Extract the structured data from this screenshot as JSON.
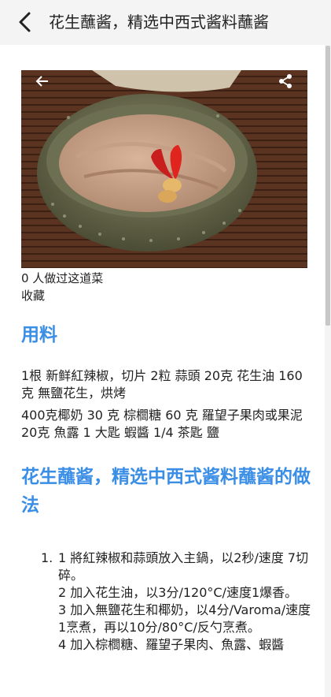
{
  "header": {
    "title": "花生蘸酱，精选中西式酱料蘸酱"
  },
  "hero": {
    "image_alt": "peanut dipping sauce bowl with red chili"
  },
  "meta": {
    "made_count": "0 人做过这道菜",
    "favorite": "收藏"
  },
  "ingredients_section": {
    "title": "用料",
    "lines": [
      "1根 新鲜紅辣椒，切片 2粒 蒜頭 20克 花生油 160克 無鹽花生，烘烤",
      "400克椰奶 30 克 棕櫚糖 60 克 羅望子果肉或果泥 20克 魚露 1 大匙 蝦醬 1/4 茶匙 鹽"
    ]
  },
  "method_section": {
    "title": "花生蘸酱，精选中西式酱料蘸酱的做法",
    "number": "1.",
    "steps": [
      "1 將紅辣椒和蒜頭放入主鍋，以2秒/速度 7切碎。",
      "2 加入花生油，以3分/120°C/速度1爆香。",
      "3 加入無鹽花生和椰奶，以4分/Varoma/速度1烹煮，再以10分/80°C/反勺烹煮。",
      "4 加入棕櫚糖、羅望子果肉、魚露、蝦醬"
    ]
  },
  "colors": {
    "accent": "#3a8ee6",
    "header_bg": "#f4f4f4"
  }
}
